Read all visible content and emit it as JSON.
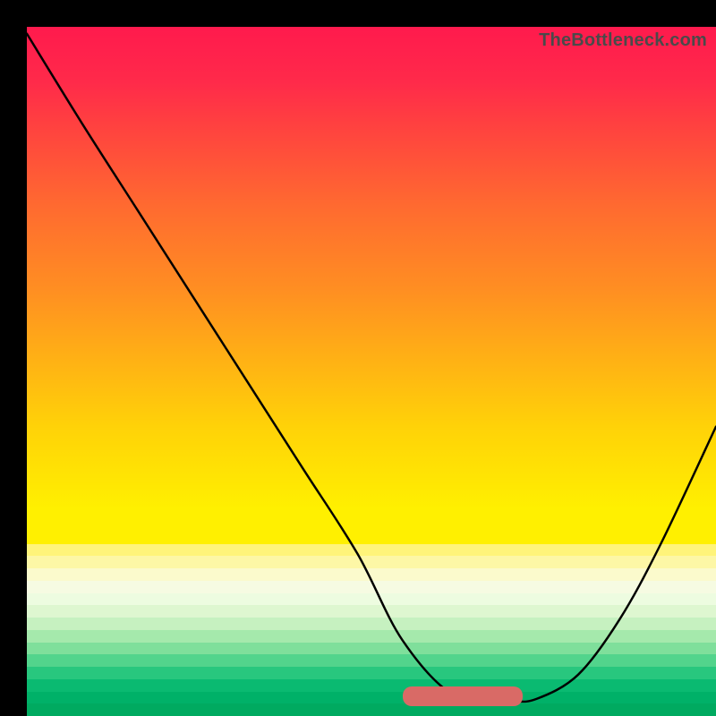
{
  "watermark": "TheBottleneck.com",
  "colors": {
    "frame": "#000000",
    "curve": "#000000",
    "marker": "#d96a66",
    "gradient_stops": [
      "#ff1a4d",
      "#ff4a3a",
      "#ff8e22",
      "#ffd208",
      "#fff000"
    ],
    "bottom_bands": [
      "#fff47a",
      "#fdf7a6",
      "#fbfacc",
      "#f6fbe2",
      "#edfce0",
      "#def7d0",
      "#c6f1c0",
      "#a5e9ac",
      "#7fdf9b",
      "#52d48c",
      "#28c77e",
      "#0aba71",
      "#00b168",
      "#00aa60"
    ]
  },
  "chart_data": {
    "type": "line",
    "title": "",
    "xlabel": "",
    "ylabel": "",
    "xlim": [
      0,
      1000
    ],
    "ylim": [
      0,
      1000
    ],
    "annotations": [
      "TheBottleneck.com"
    ],
    "series": [
      {
        "name": "curve",
        "x": [
          0,
          80,
          160,
          240,
          320,
          400,
          480,
          545,
          620,
          700,
          740,
          800,
          860,
          920,
          1000
        ],
        "values": [
          990,
          860,
          735,
          610,
          485,
          360,
          235,
          110,
          30,
          22,
          25,
          60,
          140,
          250,
          420
        ]
      }
    ],
    "marker": {
      "x_start": 545,
      "x_end": 720,
      "y": 28,
      "thickness": 22,
      "note": "short pink segment at valley bottom"
    },
    "legend": []
  }
}
